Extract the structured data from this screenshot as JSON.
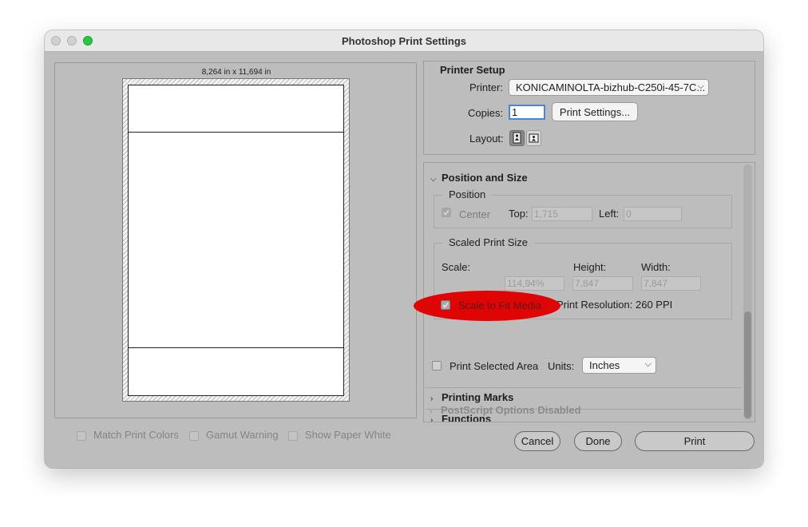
{
  "window": {
    "title": "Photoshop Print Settings"
  },
  "preview": {
    "dimensions": "8,264 in x 11,694 in"
  },
  "bottom_options": {
    "match_print_colors": "Match Print Colors",
    "gamut_warning": "Gamut Warning",
    "show_paper_white": "Show Paper White"
  },
  "printer_setup": {
    "title": "Printer Setup",
    "printer_label": "Printer:",
    "printer_value": "KONICAMINOLTA-bizhub-C250i-45-7C...",
    "copies_label": "Copies:",
    "copies_value": "1",
    "print_settings_button": "Print Settings...",
    "layout_label": "Layout:"
  },
  "position_and_size": {
    "title": "Position and Size",
    "position_group": "Position",
    "center_label": "Center",
    "top_label": "Top:",
    "top_value": "1,715",
    "left_label": "Left:",
    "left_value": "0",
    "scaled_group": "Scaled Print Size",
    "scale_label": "Scale:",
    "height_label": "Height:",
    "width_label": "Width:",
    "scale_value": "114,94%",
    "height_value": "7,847",
    "width_value": "7,847",
    "scale_to_fit_label": "Scale to Fit Media",
    "print_resolution": "Print Resolution: 260 PPI",
    "print_selected_area_label": "Print Selected Area",
    "units_label": "Units:",
    "units_value": "Inches"
  },
  "sections": {
    "printing_marks": "Printing Marks",
    "functions": "Functions",
    "postscript": "PostScript Options Disabled"
  },
  "footer": {
    "cancel": "Cancel",
    "done": "Done",
    "print": "Print"
  },
  "colors": {
    "highlight_oval": "#df0505",
    "focus_ring": "#4a86d7",
    "zoom_button": "#2ac840"
  }
}
